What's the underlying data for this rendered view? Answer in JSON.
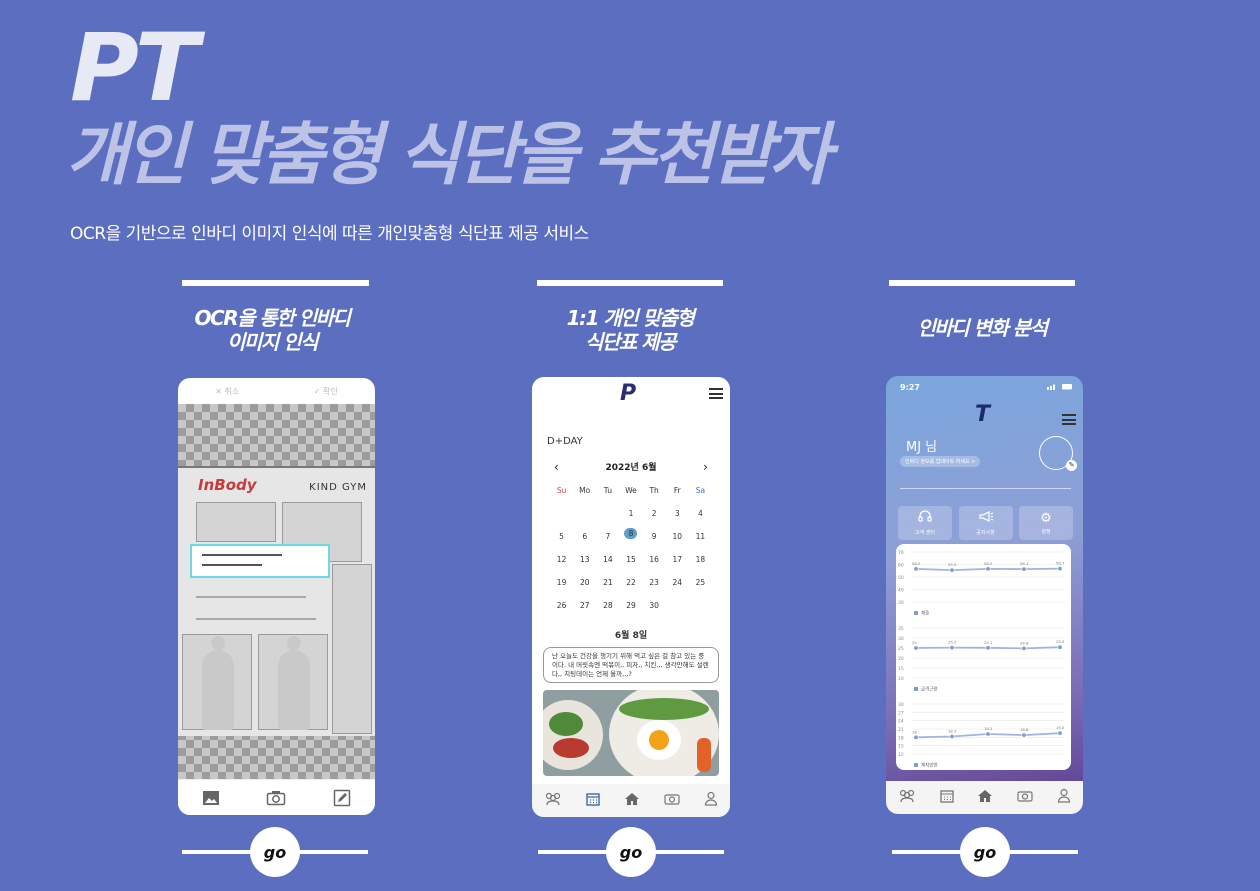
{
  "hero": {
    "pt": "PT",
    "title": "개인 맞춤형 식단을 추천받자",
    "subtitle": "OCR을 기반으로 인바디 이미지 인식에 따른 개인맞춤형 식단표 제공 서비스"
  },
  "columns": [
    {
      "title": "OCR을 통한  인바디\n이미지 인식",
      "go_label": "go"
    },
    {
      "title": "1:1 개인 맞춤형\n식단표 제공",
      "go_label": "go"
    },
    {
      "title": "인바디 변화 분석",
      "go_label": "go"
    }
  ],
  "phone1": {
    "cancel": "취소",
    "confirm": "확인",
    "brand": "InBody",
    "gym": "KIND GYM",
    "nav_icons": [
      "gallery-icon",
      "camera-icon",
      "edit-icon"
    ]
  },
  "phone2": {
    "logo": "P",
    "dday": "D+DAY",
    "month": "2022년 6월",
    "weekdays": [
      "Su",
      "Mo",
      "Tu",
      "We",
      "Th",
      "Fr",
      "Sa"
    ],
    "days": [
      "",
      "",
      "",
      "1",
      "2",
      "3",
      "4",
      "5",
      "6",
      "7",
      "8",
      "9",
      "10",
      "11",
      "12",
      "13",
      "14",
      "15",
      "16",
      "17",
      "18",
      "19",
      "20",
      "21",
      "22",
      "23",
      "24",
      "25",
      "26",
      "27",
      "28",
      "29",
      "30",
      "",
      ""
    ],
    "selected_day": "8",
    "selected_label": "6월 8일",
    "memo": "난 오늘도 건강을 챙기기 위해 먹고 싶은 걸 참고 있는 중이다. 내 머릿속엔 떡볶이,, 피자,, 치킨,,, 생각만해도 설렌다,, 치팅데이는 언제 올까,,,?",
    "accent": "#5d9ecb",
    "nav_icons": [
      "users-icon",
      "calendar-icon",
      "home-icon",
      "camera-icon",
      "profile-icon"
    ]
  },
  "phone3": {
    "time": "9:27",
    "logo": "T",
    "user": "MJ 님",
    "chip": "인바디 정보를 업데이트 하세요 >",
    "buttons": [
      {
        "icon": "headset-icon",
        "label": "고객 센터"
      },
      {
        "icon": "megaphone-icon",
        "label": "공지사항"
      },
      {
        "icon": "gear-icon",
        "label": "설정"
      }
    ],
    "chart_data": [
      {
        "type": "line",
        "series": [
          {
            "name": "체중",
            "values": [
              56.5,
              55.5,
              56.5,
              56.3,
              56.7
            ]
          }
        ],
        "ylim": [
          30,
          70
        ],
        "yticks": [
          "70",
          "60",
          "50",
          "40",
          "30"
        ]
      },
      {
        "type": "line",
        "series": [
          {
            "name": "골격근량",
            "values": [
              25,
              25.2,
              25.1,
              24.8,
              25.4
            ]
          }
        ],
        "ylim": [
          10,
          35
        ],
        "yticks": [
          "35",
          "30",
          "25",
          "20",
          "15",
          "10"
        ]
      },
      {
        "type": "line",
        "series": [
          {
            "name": "체지방량",
            "values": [
              18,
              18.3,
              19.2,
              18.8,
              19.5
            ]
          }
        ],
        "ylim": [
          12,
          30
        ],
        "yticks": [
          "30",
          "27",
          "24",
          "21",
          "18",
          "15",
          "12"
        ]
      }
    ],
    "nav_icons": [
      "users-icon",
      "calendar-icon",
      "home-icon",
      "camera-icon",
      "profile-icon"
    ]
  }
}
